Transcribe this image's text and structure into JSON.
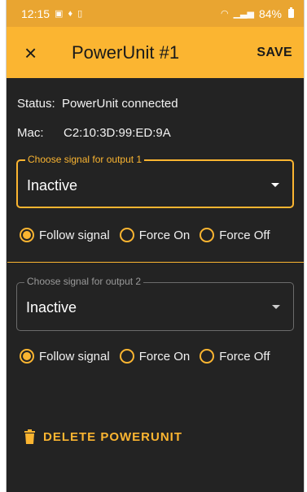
{
  "status_bar": {
    "time": "12:15",
    "battery": "84%",
    "icons": [
      "gallery-icon",
      "location-icon",
      "phone-icon",
      "wifi-icon",
      "signal-icon",
      "battery-icon"
    ]
  },
  "app_bar": {
    "title": "PowerUnit #1",
    "save_label": "SAVE",
    "close_icon": "×"
  },
  "info": {
    "status_label": "Status:",
    "status_value": "PowerUnit connected",
    "mac_label": "Mac:",
    "mac_value": "C2:10:3D:99:ED:9A"
  },
  "output1": {
    "legend": "Choose signal for output 1",
    "value": "Inactive",
    "options": [
      {
        "label": "Follow signal",
        "selected": true
      },
      {
        "label": "Force On",
        "selected": false
      },
      {
        "label": "Force Off",
        "selected": false
      }
    ]
  },
  "output2": {
    "legend": "Choose signal for output 2",
    "value": "Inactive",
    "options": [
      {
        "label": "Follow signal",
        "selected": true
      },
      {
        "label": "Force On",
        "selected": false
      },
      {
        "label": "Force Off",
        "selected": false
      }
    ]
  },
  "delete_label": "DELETE POWERUNIT",
  "colors": {
    "accent": "#fbb531",
    "status_bar": "#e9a531",
    "background": "#232323",
    "text": "#f2f2f2"
  }
}
